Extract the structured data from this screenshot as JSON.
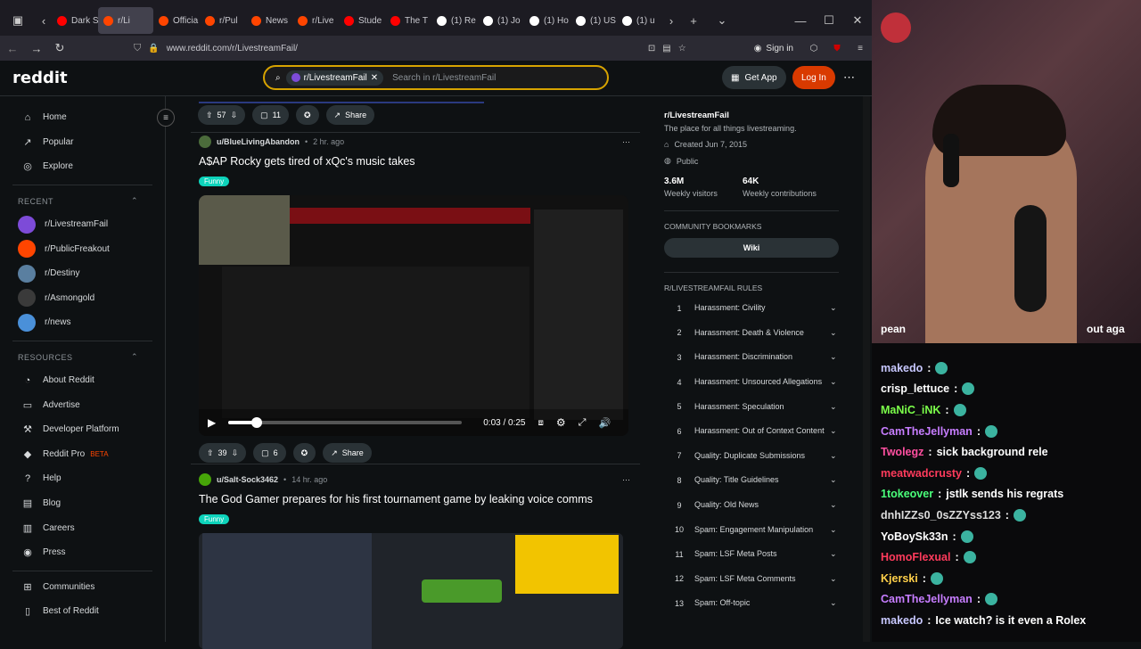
{
  "browser": {
    "tabs": [
      {
        "label": "Dark S",
        "color": "#ff0000"
      },
      {
        "label": "r/Li",
        "color": "#ff4500"
      },
      {
        "label": "Officia",
        "color": "#ff4500"
      },
      {
        "label": "r/Pul",
        "color": "#ff4500"
      },
      {
        "label": "News",
        "color": "#ff4500"
      },
      {
        "label": "r/Live",
        "color": "#ff4500"
      },
      {
        "label": "Stude",
        "color": "#ff0000"
      },
      {
        "label": "The T",
        "color": "#ff0000"
      },
      {
        "label": "(1) Re",
        "color": "#ffffff"
      },
      {
        "label": "(1) Jo",
        "color": "#ffffff"
      },
      {
        "label": "(1) Ho",
        "color": "#ffffff"
      },
      {
        "label": "(1) US",
        "color": "#ffffff"
      },
      {
        "label": "(1) u",
        "color": "#ffffff"
      }
    ],
    "url": "www.reddit.com/r/LivestreamFail/",
    "sign_in": "Sign in"
  },
  "header": {
    "logo": "reddit",
    "search_chip": "r/LivestreamFail",
    "search_placeholder": "Search in r/LivestreamFail",
    "get_app": "Get App",
    "log_in": "Log In"
  },
  "sidebar": {
    "main": [
      {
        "label": "Home",
        "icon": "home-icon"
      },
      {
        "label": "Popular",
        "icon": "popular-icon"
      },
      {
        "label": "Explore",
        "icon": "explore-icon"
      }
    ],
    "recent_header": "RECENT",
    "recent": [
      {
        "label": "r/LivestreamFail",
        "color": "#7d4bd8"
      },
      {
        "label": "r/PublicFreakout",
        "color": "#ff4500"
      },
      {
        "label": "r/Destiny",
        "color": "#5a7fa0"
      },
      {
        "label": "r/Asmongold",
        "color": "#3a3a3a"
      },
      {
        "label": "r/news",
        "color": "#4a90d9"
      }
    ],
    "resources_header": "RESOURCES",
    "resources": [
      {
        "label": "About Reddit"
      },
      {
        "label": "Advertise"
      },
      {
        "label": "Developer Platform"
      },
      {
        "label": "Reddit Pro",
        "badge": "BETA"
      },
      {
        "label": "Help"
      },
      {
        "label": "Blog"
      },
      {
        "label": "Careers"
      },
      {
        "label": "Press"
      }
    ],
    "communities": "Communities",
    "best_of": "Best of Reddit"
  },
  "feed": {
    "top_actions": {
      "votes": "57",
      "comments": "11",
      "share": "Share"
    },
    "post1": {
      "author": "u/BlueLivingAbandon",
      "time": "2 hr. ago",
      "title": "A$AP Rocky gets tired of xQc's music takes",
      "flair": "Funny",
      "time_display": "0:03 / 0:25",
      "progress": 0.12,
      "votes": "39",
      "comments": "6",
      "share": "Share"
    },
    "post2": {
      "author": "u/Salt-Sock3462",
      "time": "14 hr. ago",
      "title": "The God Gamer prepares for his first tournament game by leaking voice comms",
      "flair": "Funny"
    }
  },
  "right": {
    "sub_name": "r/LivestreamFail",
    "sub_desc": "The place for all things livestreaming.",
    "created": "Created Jun 7, 2015",
    "visibility": "Public",
    "visitors": "3.6M",
    "visitors_label": "Weekly visitors",
    "contrib": "64K",
    "contrib_label": "Weekly contributions",
    "bookmarks_header": "COMMUNITY BOOKMARKS",
    "wiki": "Wiki",
    "rules_header": "R/LIVESTREAMFAIL RULES",
    "rules": [
      {
        "n": "1",
        "t": "Harassment: Civility"
      },
      {
        "n": "2",
        "t": "Harassment: Death & Violence"
      },
      {
        "n": "3",
        "t": "Harassment: Discrimination"
      },
      {
        "n": "4",
        "t": "Harassment: Unsourced Allegations"
      },
      {
        "n": "5",
        "t": "Harassment: Speculation"
      },
      {
        "n": "6",
        "t": "Harassment: Out of Context Content"
      },
      {
        "n": "7",
        "t": "Quality: Duplicate Submissions"
      },
      {
        "n": "8",
        "t": "Quality: Title Guidelines"
      },
      {
        "n": "9",
        "t": "Quality: Old News"
      },
      {
        "n": "10",
        "t": "Spam: Engagement Manipulation"
      },
      {
        "n": "11",
        "t": "Spam: LSF Meta Posts"
      },
      {
        "n": "12",
        "t": "Spam: LSF Meta Comments"
      },
      {
        "n": "13",
        "t": "Spam: Off-topic"
      }
    ]
  },
  "stream": {
    "caption_left": "pean",
    "caption_right": "out aga",
    "chat": [
      {
        "user": "makedo",
        "color": "#c8c8ff",
        "msg": ""
      },
      {
        "user": "crisp_lettuce",
        "color": "#ffffff",
        "msg": ""
      },
      {
        "user": "MaNiC_iNK",
        "color": "#7cff4a",
        "msg": ""
      },
      {
        "user": "CamTheJellyman",
        "color": "#c77dff",
        "msg": ""
      },
      {
        "user": "Twolegz",
        "color": "#ff4fa0",
        "msg": "sick background rele"
      },
      {
        "user": "meatwadcrusty",
        "color": "#ff3b5c",
        "msg": ""
      },
      {
        "user": "1tokeover",
        "color": "#4aff7a",
        "msg": "jstlk sends his regrats"
      },
      {
        "user": "dnhIZZs0_0sZZYss123",
        "color": "#dcdcdc",
        "msg": ""
      },
      {
        "user": "YoBoySk33n",
        "color": "#ffffff",
        "msg": ""
      },
      {
        "user": "HomoFlexual",
        "color": "#ff3b5c",
        "msg": ""
      },
      {
        "user": "Kjerski",
        "color": "#ffd04a",
        "msg": ""
      },
      {
        "user": "CamTheJellyman",
        "color": "#c77dff",
        "msg": ""
      },
      {
        "user": "makedo",
        "color": "#c8c8ff",
        "msg": "Ice watch? is it even a Rolex"
      }
    ]
  }
}
